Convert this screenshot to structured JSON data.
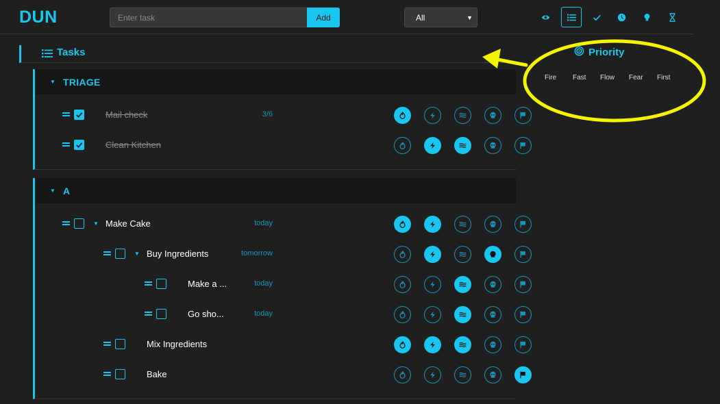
{
  "app": {
    "logo": "DUN"
  },
  "toolbar": {
    "task_placeholder": "Enter task",
    "add_label": "Add",
    "filter_selected": "All"
  },
  "view_buttons": [
    {
      "name": "eye",
      "icon": "eye-icon",
      "active": false
    },
    {
      "name": "list",
      "icon": "list-icon",
      "active": true
    },
    {
      "name": "check",
      "icon": "check-icon",
      "active": false
    },
    {
      "name": "clock",
      "icon": "clock-icon",
      "active": false
    },
    {
      "name": "bulb",
      "icon": "lightbulb-icon",
      "active": false
    },
    {
      "name": "hourglass",
      "icon": "hourglass-icon",
      "active": false
    }
  ],
  "tasks_section": {
    "title": "Tasks"
  },
  "priority_legend": {
    "title": "Priority",
    "items": [
      "Fire",
      "Fast",
      "Flow",
      "Fear",
      "First"
    ]
  },
  "priority_icons": [
    "fire-icon",
    "bolt-icon",
    "waves-icon",
    "skull-icon",
    "flag-icon"
  ],
  "groups": [
    {
      "title": "TRIAGE",
      "tasks": [
        {
          "name": "Mail check",
          "done": true,
          "meta": "3/6",
          "level": 0,
          "expandable": false,
          "priority": [
            true,
            false,
            false,
            false,
            false
          ]
        },
        {
          "name": "Clean Kitchen",
          "done": true,
          "meta": "",
          "level": 0,
          "expandable": false,
          "priority": [
            false,
            true,
            true,
            false,
            false
          ]
        }
      ]
    },
    {
      "title": "A",
      "tasks": [
        {
          "name": "Make Cake",
          "done": false,
          "meta": "today",
          "level": 0,
          "expandable": true,
          "priority": [
            true,
            true,
            false,
            false,
            false
          ]
        },
        {
          "name": "Buy Ingredients",
          "done": false,
          "meta": "tomorrow",
          "level": 1,
          "expandable": true,
          "priority": [
            false,
            true,
            false,
            true,
            false
          ]
        },
        {
          "name": "Make a ...",
          "done": false,
          "meta": "today",
          "level": 2,
          "expandable": false,
          "priority": [
            false,
            false,
            true,
            false,
            false
          ]
        },
        {
          "name": "Go sho...",
          "done": false,
          "meta": "today",
          "level": 2,
          "expandable": false,
          "priority": [
            false,
            false,
            true,
            false,
            false
          ]
        },
        {
          "name": "Mix Ingredients",
          "done": false,
          "meta": "",
          "level": 1,
          "expandable": false,
          "priority": [
            true,
            true,
            true,
            false,
            false
          ]
        },
        {
          "name": "Bake",
          "done": false,
          "meta": "",
          "level": 1,
          "expandable": false,
          "priority": [
            false,
            false,
            false,
            false,
            true
          ]
        }
      ]
    }
  ],
  "colors": {
    "accent": "#18c6f0",
    "accent_dim": "#1596bc",
    "background": "#1f1f1f",
    "annotation": "#f5f500"
  }
}
